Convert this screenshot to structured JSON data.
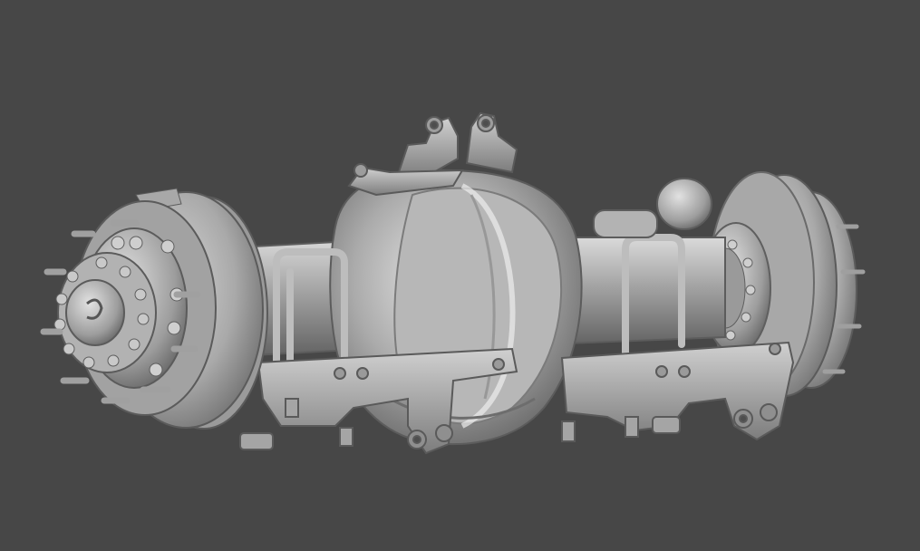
{
  "viewport": {
    "background_color": "#474747",
    "model_color": "#b9b9b9",
    "shading_dark": "#5e5e5e",
    "shading_light": "#e4e4e4",
    "subject": "axle-assembly-render"
  }
}
